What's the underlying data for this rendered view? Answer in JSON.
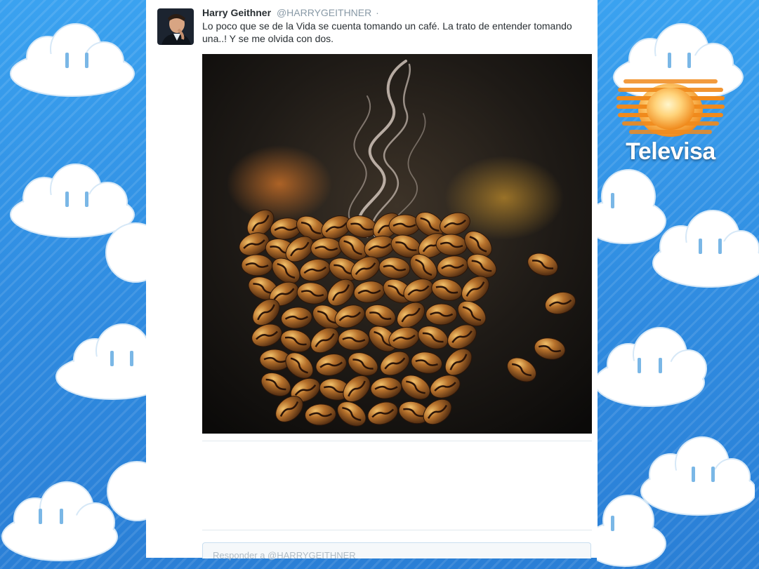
{
  "tweet": {
    "author_name": "Harry Geithner",
    "author_handle": "@HARRYGEITHNER",
    "separator": "·",
    "text": "Lo poco que se de la Vida se cuenta tomando un café. La trato de entender tomando una..! Y se me olvida con dos.",
    "reply_placeholder": "Responder a @HARRYGEITHNER"
  },
  "overlay": {
    "logo_text": "Televisa"
  },
  "icons": [
    "avatar-photo",
    "coffee-beans-cup-image",
    "televisa-logo-icon",
    "cloud-icon"
  ],
  "colors": {
    "sky": "#2f8be0",
    "card": "#ffffff",
    "name": "#292f33",
    "handle": "#8899a6",
    "logo_orange": "#f08a1c"
  }
}
